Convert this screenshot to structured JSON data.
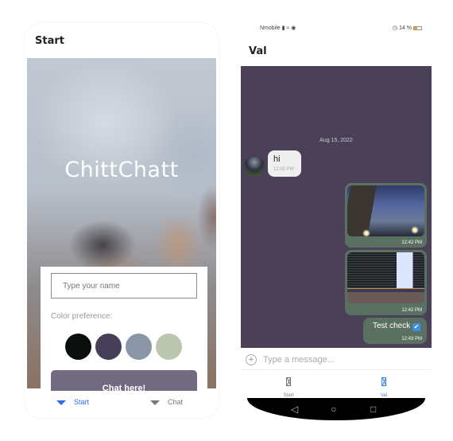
{
  "left_screen": {
    "title": "Start",
    "brand": "ChittChatt",
    "name_input": {
      "value": "",
      "placeholder": "Type your name"
    },
    "color_label": "Color preference:",
    "colors": [
      {
        "name": "black",
        "hex": "#0b0f0b"
      },
      {
        "name": "purple",
        "hex": "#473f57"
      },
      {
        "name": "slate",
        "hex": "#8a96a8"
      },
      {
        "name": "sage",
        "hex": "#bac6ad"
      }
    ],
    "chat_button": {
      "label": "Chat here!",
      "color": "#726a80"
    },
    "tabs": [
      {
        "label": "Start",
        "active": true,
        "color": "#2a6cf0"
      },
      {
        "label": "Chat",
        "active": false,
        "color": "#777777"
      }
    ]
  },
  "right_screen": {
    "status_bar": {
      "carrier": "Nmobile",
      "battery": "14 %"
    },
    "title": "Val",
    "chat_bg": "#4a4057",
    "bubble_out_color": "#5a7060",
    "date_separator": "Aug 15, 2022",
    "messages": [
      {
        "direction": "in",
        "type": "text",
        "text": "hi",
        "time": "12:00 PM"
      },
      {
        "direction": "out",
        "type": "image",
        "image": "building-at-dusk",
        "time": "12:42 PM"
      },
      {
        "direction": "out",
        "type": "image",
        "image": "code-on-monitor",
        "time": "12:42 PM"
      },
      {
        "direction": "out",
        "type": "text",
        "text": "Test check",
        "emoji": "✔",
        "time": "12:43 PM"
      }
    ],
    "composer": {
      "value": "",
      "placeholder": "Type a message..."
    },
    "tabs": [
      {
        "label": "Start",
        "active": false,
        "color": "#777777"
      },
      {
        "label": "Val",
        "active": true,
        "color": "#3a86e8"
      }
    ],
    "nav_buttons": [
      "back",
      "home",
      "recents"
    ]
  }
}
